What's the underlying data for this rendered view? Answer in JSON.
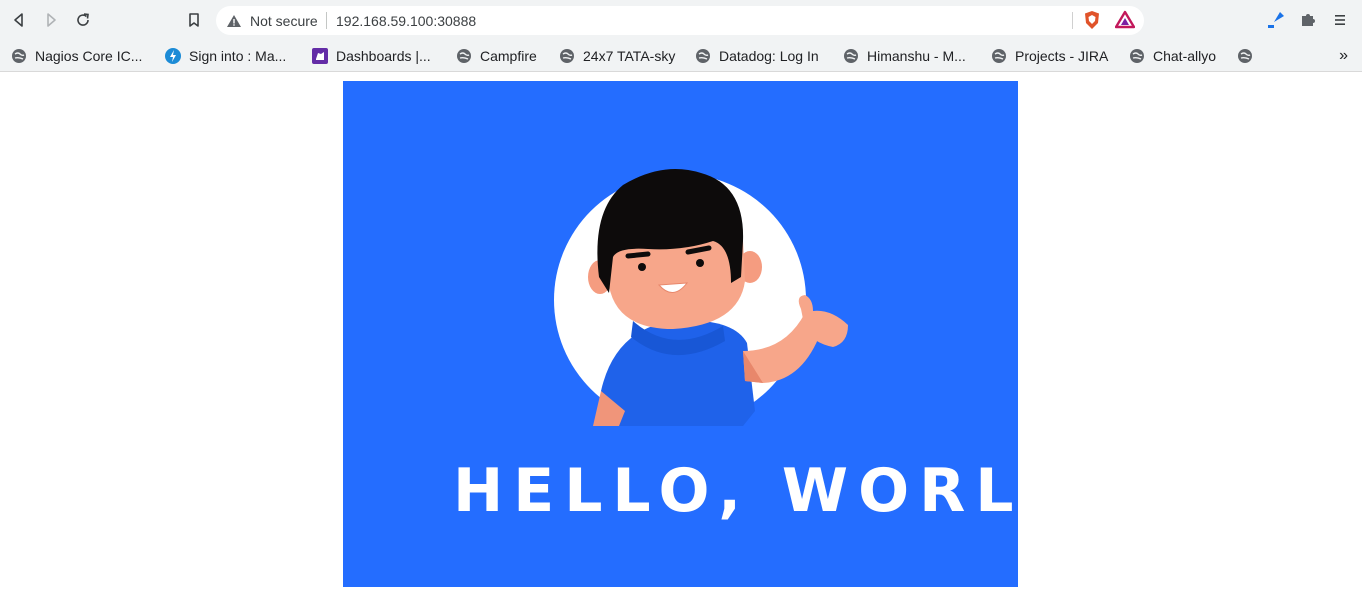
{
  "browser": {
    "nav": [
      "back-icon",
      "forward-icon",
      "reload-icon",
      "bookmark-icon"
    ],
    "omnibox": {
      "security_label": "Not secure",
      "url": "192.168.59.100:30888"
    },
    "extensions": [
      "brave-shield-icon",
      "brave-rewards-icon",
      "pen-extension-icon",
      "puzzle-icon",
      "menu-icon"
    ],
    "colors": {
      "toolbar_bg": "#f1f3f4",
      "brave_orange": "#e0532a"
    }
  },
  "bookmarks": {
    "items": [
      {
        "label": "Nagios Core IC...",
        "icon": "globe-icon"
      },
      {
        "label": "Sign into : Ma...",
        "icon": "bolt-icon"
      },
      {
        "label": "Dashboards |...",
        "icon": "dog-icon"
      },
      {
        "label": "Campfire",
        "icon": "globe-icon"
      },
      {
        "label": "24x7 TATA-sky",
        "icon": "globe-icon"
      },
      {
        "label": "Datadog: Log In",
        "icon": "globe-icon"
      },
      {
        "label": "Himanshu - M...",
        "icon": "globe-icon"
      },
      {
        "label": "Projects - JIRA",
        "icon": "globe-icon"
      },
      {
        "label": "Chat-allyo",
        "icon": "globe-icon"
      },
      {
        "label": "",
        "icon": "globe-icon"
      }
    ],
    "overflow": "»"
  },
  "page": {
    "heading": "HELLO, WORLD!",
    "colors": {
      "background": "#246dff",
      "circle": "#ffffff",
      "skin": "#f7a68a",
      "hair": "#0d0b0b",
      "shirt": "#246dff"
    }
  }
}
